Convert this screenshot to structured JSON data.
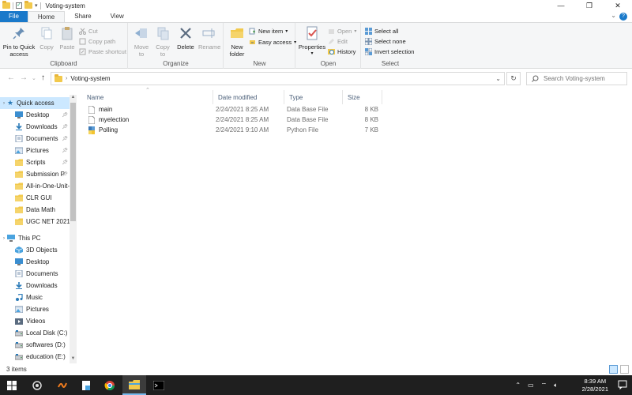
{
  "window": {
    "title": "Voting-system",
    "minimize": "—",
    "maximize": "❐",
    "close": "✕"
  },
  "tabs": [
    {
      "label": "File"
    },
    {
      "label": "Home"
    },
    {
      "label": "Share"
    },
    {
      "label": "View"
    }
  ],
  "ribbon": {
    "clipboard": {
      "label": "Clipboard",
      "pin": "Pin to Quick\naccess",
      "copy": "Copy",
      "paste": "Paste",
      "cut": "Cut",
      "copy_path": "Copy path",
      "paste_shortcut": "Paste shortcut"
    },
    "organize": {
      "label": "Organize",
      "move_to": "Move\nto",
      "copy_to": "Copy\nto",
      "delete": "Delete",
      "rename": "Rename"
    },
    "new": {
      "label": "New",
      "new_folder": "New\nfolder",
      "new_item": "New item",
      "easy_access": "Easy access"
    },
    "open": {
      "label": "Open",
      "properties": "Properties",
      "open": "Open",
      "edit": "Edit",
      "history": "History"
    },
    "select": {
      "label": "Select",
      "select_all": "Select all",
      "select_none": "Select none",
      "invert": "Invert selection"
    }
  },
  "address": {
    "crumb": "Voting-system",
    "search_placeholder": "Search Voting-system"
  },
  "navpane": {
    "quick_access": "Quick access",
    "quick_items": [
      {
        "label": "Desktop",
        "pinned": true,
        "icon": "desktop-icon"
      },
      {
        "label": "Downloads",
        "pinned": true,
        "icon": "download-icon"
      },
      {
        "label": "Documents",
        "pinned": true,
        "icon": "document-icon"
      },
      {
        "label": "Pictures",
        "pinned": true,
        "icon": "picture-icon"
      },
      {
        "label": "Scripts",
        "pinned": true,
        "icon": "folder-icon"
      },
      {
        "label": "Submission P",
        "pinned": true,
        "icon": "folder-icon"
      },
      {
        "label": "All-in-One-Unit-",
        "pinned": false,
        "icon": "folder-icon"
      },
      {
        "label": "CLR GUI",
        "pinned": false,
        "icon": "folder-icon"
      },
      {
        "label": "Data Math",
        "pinned": false,
        "icon": "folder-icon"
      },
      {
        "label": "UGC NET 2021",
        "pinned": false,
        "icon": "folder-icon"
      }
    ],
    "this_pc": "This PC",
    "pc_items": [
      {
        "label": "3D Objects",
        "icon": "3d-objects-icon"
      },
      {
        "label": "Desktop",
        "icon": "desktop-icon"
      },
      {
        "label": "Documents",
        "icon": "document-icon"
      },
      {
        "label": "Downloads",
        "icon": "download-icon"
      },
      {
        "label": "Music",
        "icon": "music-icon"
      },
      {
        "label": "Pictures",
        "icon": "picture-icon"
      },
      {
        "label": "Videos",
        "icon": "video-icon"
      },
      {
        "label": "Local Disk (C:)",
        "icon": "disk-icon"
      },
      {
        "label": "softwares (D:)",
        "icon": "disk-icon"
      },
      {
        "label": "education (E:)",
        "icon": "disk-icon"
      }
    ]
  },
  "columns": {
    "name": "Name",
    "date": "Date modified",
    "type": "Type",
    "size": "Size"
  },
  "files": [
    {
      "name": "main",
      "date": "2/24/2021 8:25 AM",
      "type": "Data Base File",
      "size": "8 KB"
    },
    {
      "name": "myelection",
      "date": "2/24/2021 8:25 AM",
      "type": "Data Base File",
      "size": "8 KB"
    },
    {
      "name": "Polling",
      "date": "2/24/2021 9:10 AM",
      "type": "Python File",
      "size": "7 KB"
    }
  ],
  "status": {
    "item_count": "3 items"
  },
  "clock": {
    "time": "8:39 AM",
    "date": "2/28/2021"
  },
  "colors": {
    "accent": "#1979ca",
    "selected": "#cce8ff",
    "taskbar": "#1f1f1f"
  }
}
